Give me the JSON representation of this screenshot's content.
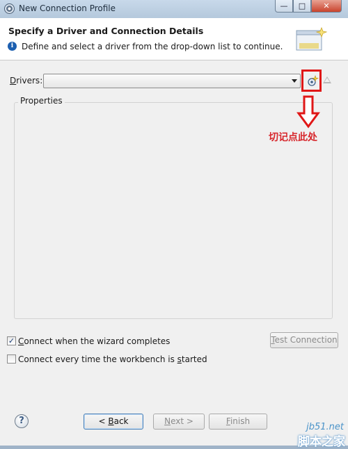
{
  "window": {
    "title": "New Connection Profile",
    "controls": {
      "minimize": "—",
      "maximize": "□",
      "close": "✕"
    }
  },
  "header": {
    "title": "Specify a Driver and Connection Details",
    "message": "Define and select a driver from the drop-down list to continue.",
    "info_icon": "i"
  },
  "drivers": {
    "label_prefix": "",
    "label_access": "D",
    "label_rest": "rivers:",
    "value": ""
  },
  "properties": {
    "label": "Properties"
  },
  "annotation": {
    "text": "切记点此处",
    "color": "#d7262b"
  },
  "options": {
    "connect_on_finish": {
      "label_pre": "",
      "label_access": "C",
      "label_post": "onnect when the wizard completes",
      "checked": "✓"
    },
    "connect_every_time": {
      "label_pre": "Connect every time the workbench is ",
      "label_access": "s",
      "label_post": "tarted"
    }
  },
  "buttons": {
    "test_pre": "",
    "test_access": "T",
    "test_post": "est Connection",
    "back_pre": "< ",
    "back_access": "B",
    "back_post": "ack",
    "next_pre": "",
    "next_access": "N",
    "next_post": "ext >",
    "finish_pre": "",
    "finish_access": "F",
    "finish_post": "inish",
    "help": "?"
  },
  "watermark": {
    "url": "jb51.net",
    "name": "脚本之家"
  }
}
